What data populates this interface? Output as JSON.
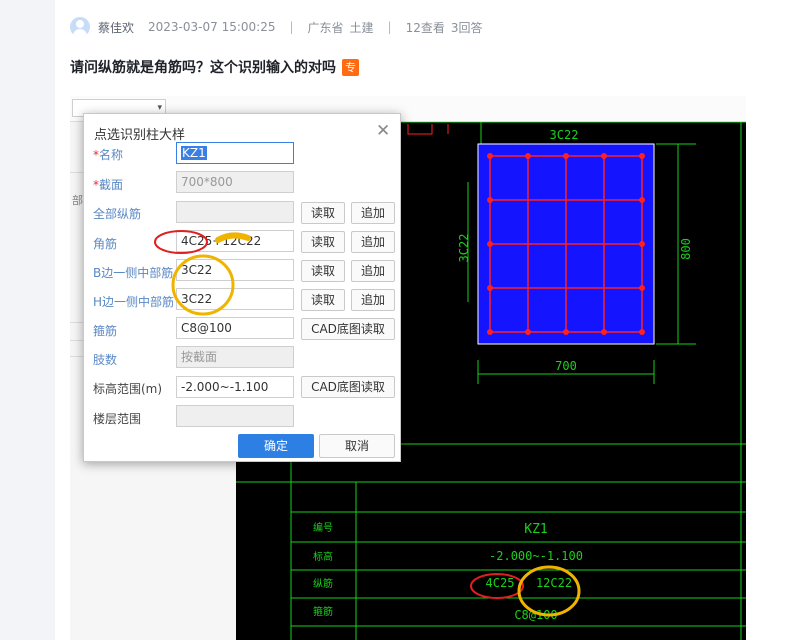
{
  "post": {
    "author": "蔡佳欢",
    "datetime": "2023-03-07 15:00:25",
    "separator": "|",
    "location": "广东省",
    "category": "土建",
    "views": "12查看",
    "answers": "3回答",
    "question": "请问纵筋就是角筋吗？这个识别输入的对吗",
    "tag": "专"
  },
  "software": {
    "select_arrow": "▾",
    "left_partial_text": "部"
  },
  "dialog": {
    "title": "点选识别柱大样",
    "close": "✕",
    "rows": [
      {
        "label": "名称",
        "required": true,
        "value": "KZ1"
      },
      {
        "label": "截面",
        "required": true,
        "value": "700*800"
      },
      {
        "label": "全部纵筋",
        "value": "",
        "btn1": "读取",
        "btn2": "追加"
      },
      {
        "label": "角筋",
        "value": "4C25+12C22",
        "btn1": "读取",
        "btn2": "追加"
      },
      {
        "label": "B边一侧中部筋",
        "value": "3C22",
        "btn1": "读取",
        "btn2": "追加"
      },
      {
        "label": "H边一侧中部筋",
        "value": "3C22",
        "btn1": "读取",
        "btn2": "追加"
      },
      {
        "label": "箍筋",
        "value": "C8@100",
        "btn_wide": "CAD底图读取"
      },
      {
        "label": "肢数",
        "value": "按截面"
      },
      {
        "label": "标高范围(m)",
        "value": "-2.000~-1.100",
        "btn_wide": "CAD底图读取"
      },
      {
        "label": "楼层范围",
        "value": ""
      }
    ],
    "ok": "确定",
    "cancel": "取消"
  },
  "cad": {
    "width_dim": "700",
    "height_dim": "800",
    "top_label": "3C22",
    "left_label": "3C22",
    "table_labels": [
      "编号",
      "标高",
      "纵筋",
      "箍筋"
    ],
    "name": "KZ1",
    "elevation": "-2.000~-1.100",
    "rebar_a": "4C25",
    "rebar_b": "12C22",
    "stirrup": "C8@100",
    "colors": {
      "green": "#19d119",
      "blue": "#1414ff",
      "red": "#ff2020"
    }
  },
  "annotations": {
    "red": "#e02020",
    "yellow": "#f0b400"
  }
}
